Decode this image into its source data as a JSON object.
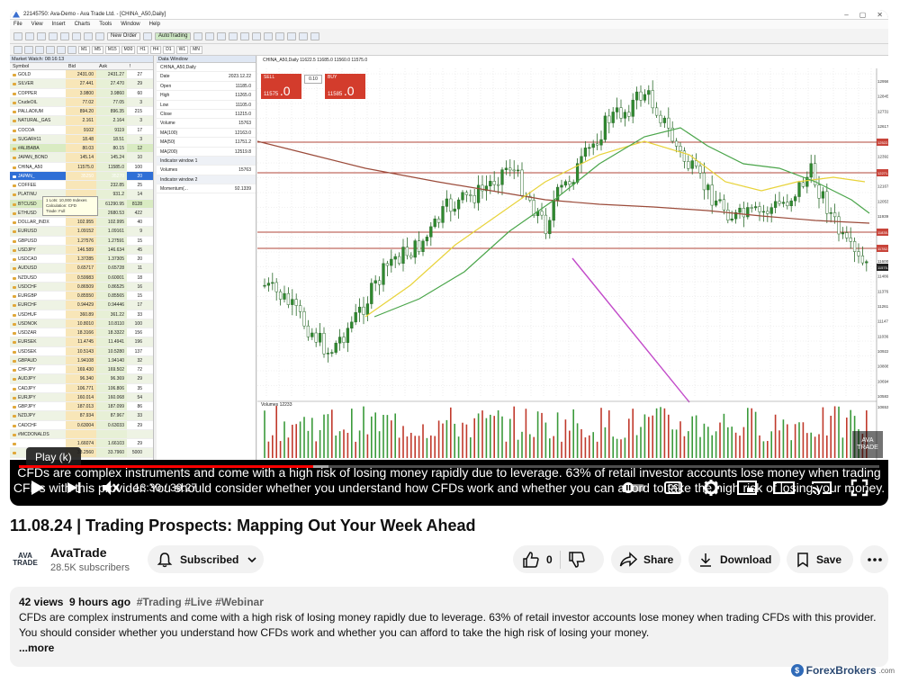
{
  "platform": {
    "title": "22145750: Ava-Demo - Ava Trade Ltd. - [CHINA_A50,Daily]",
    "menu": [
      "File",
      "View",
      "Insert",
      "Charts",
      "Tools",
      "Window",
      "Help"
    ],
    "toolbar": {
      "new_order": "New Order",
      "autotrading": "AutoTrading"
    },
    "timeframes": [
      "M1",
      "M5",
      "M15",
      "M30",
      "H1",
      "H4",
      "D1",
      "W1",
      "MN"
    ],
    "market_watch": {
      "title": "Market Watch: 08:16:13",
      "columns": [
        "Symbol",
        "Bid",
        "Ask",
        "!"
      ],
      "rows": [
        [
          "GOLD",
          "2431.00",
          "2431.27",
          "27"
        ],
        [
          "SILVER",
          "27.441",
          "27.470",
          "29"
        ],
        [
          "COPPER",
          "3.9800",
          "3.9860",
          "60"
        ],
        [
          "CrudeOIL",
          "77.02",
          "77.05",
          "3"
        ],
        [
          "PALLADIUM",
          "894.20",
          "896.35",
          "215"
        ],
        [
          "NATURAL_GAS",
          "2.161",
          "2.164",
          "3"
        ],
        [
          "COCOA",
          "9102",
          "9119",
          "17"
        ],
        [
          "SUGAR#11",
          "18.48",
          "18.51",
          "3"
        ],
        [
          "#ALIBABA",
          "80.03",
          "80.15",
          "12"
        ],
        [
          "JAPAN_BOND",
          "145.14",
          "145.24",
          "10"
        ],
        [
          "CHINA_A50",
          "11575.0",
          "11585.0",
          "100"
        ],
        [
          "JAPAN_",
          "35250",
          "35270",
          "20"
        ],
        [
          "COFFEE",
          "",
          "232.85",
          "25"
        ],
        [
          "PLATINU",
          "",
          "931.2",
          "14"
        ],
        [
          "BTCUSD",
          "",
          "61290.95",
          "8128"
        ],
        [
          "ETHUSD",
          "2676.31",
          "2680.53",
          "422"
        ],
        [
          "DOLLAR_INDX",
          "102.955",
          "102.995",
          "40"
        ],
        [
          "EURUSD",
          "1.09152",
          "1.09161",
          "9"
        ],
        [
          "GBPUSD",
          "1.27576",
          "1.27591",
          "15"
        ],
        [
          "USDJPY",
          "146.589",
          "146.634",
          "45"
        ],
        [
          "USDCAD",
          "1.37285",
          "1.37305",
          "20"
        ],
        [
          "AUDUSD",
          "0.65717",
          "0.65728",
          "11"
        ],
        [
          "NZDUSD",
          "0.59983",
          "0.60001",
          "18"
        ],
        [
          "USDCHF",
          "0.86509",
          "0.86525",
          "16"
        ],
        [
          "EURGBP",
          "0.85550",
          "0.85565",
          "15"
        ],
        [
          "EURCHF",
          "0.94429",
          "0.94446",
          "17"
        ],
        [
          "USDHUF",
          "360.89",
          "361.22",
          "33"
        ],
        [
          "USDNOK",
          "10.8010",
          "10.8110",
          "100"
        ],
        [
          "USDZAR",
          "18.3166",
          "18.3322",
          "156"
        ],
        [
          "EURSEK",
          "11.4745",
          "11.4941",
          "196"
        ],
        [
          "USDSEK",
          "10.5143",
          "10.5280",
          "137"
        ],
        [
          "GBPAUD",
          "1.94108",
          "1.94140",
          "32"
        ],
        [
          "CHFJPY",
          "169.430",
          "169.502",
          "72"
        ],
        [
          "AUDJPY",
          "96.340",
          "96.369",
          "29"
        ],
        [
          "CADJPY",
          "106.771",
          "106.806",
          "35"
        ],
        [
          "EURJPY",
          "160.014",
          "160.068",
          "54"
        ],
        [
          "GBPJPY",
          "187.013",
          "187.099",
          "86"
        ],
        [
          "NZDJPY",
          "87.934",
          "87.967",
          "33"
        ],
        [
          "CADCHF",
          "0.63004",
          "0.63033",
          "29"
        ],
        [
          "#MCDONALDS",
          "",
          "",
          ""
        ],
        [
          "",
          "1.66074",
          "1.66103",
          "29"
        ],
        [
          "",
          "33.2560",
          "33.7960",
          "5000"
        ]
      ],
      "tooltip": [
        "1 Lots: 10,000 Indexes",
        "Calculation: CFD",
        "Trade: Full"
      ]
    },
    "data_window": {
      "title": "Data Window",
      "rows": [
        [
          "CHINA_A50,Daily",
          ""
        ],
        [
          "Date",
          "2023.12.22"
        ],
        [
          "Open",
          "11185.0"
        ],
        [
          "High",
          "11265.0"
        ],
        [
          "Low",
          "11105.0"
        ],
        [
          "Close",
          "11215.0"
        ],
        [
          "Volume",
          "15763"
        ],
        [
          "MA(100)",
          "12163.0"
        ],
        [
          "MA(50)",
          "11751.2"
        ],
        [
          "MA(200)",
          "12519.8"
        ],
        [
          "Indicator window 1",
          ""
        ],
        [
          "Volumes",
          "15763"
        ],
        [
          "Indicator window 2",
          ""
        ],
        [
          "Momentum(...",
          "92.1339"
        ]
      ]
    },
    "chart": {
      "label": "CHINA_A50,Daily  11622.5 11685.0 11560.0 11575.0",
      "sell_label": "SELL",
      "buy_label": "BUY",
      "lot": "0.10",
      "sell_price_small": "11575",
      "sell_price_big": ".0",
      "buy_price_small": "11585",
      "buy_price_big": ".0",
      "price_ticks": [
        "12956.0",
        "12845.0",
        "12731.0",
        "12617.0",
        "12503.0",
        "12392.0",
        "12278.0",
        "12167.0",
        "12053.0",
        "11939.0",
        "11825.0",
        "11711.0",
        "11600.0",
        "11486.0",
        "11376.0",
        "11261.0",
        "11147.0",
        "11036.0",
        "10922.0",
        "10808.0",
        "10694.0",
        "10583.0"
      ],
      "price_tags": [
        "12522.5",
        "12271.5",
        "11835.5",
        "11782.5",
        "11575.0"
      ],
      "volume_label": "Volumes 12233",
      "volume_tick": "10653",
      "watermark": [
        "AVA",
        "TRADE"
      ]
    }
  },
  "player": {
    "play_tooltip": "Play (k)",
    "subtitle_line1": "CFDs are complex instruments and come with a high risk of losing money rapidly due to leverage. 63% of retail investor accounts lose money when trading",
    "subtitle_line2": "CFDs with this provider. You should consider whether you understand how CFDs work and whether you can afford to take the high risk of losing your money.",
    "time_current": "13:30",
    "time_total": "39:27",
    "progress_played": 0.342,
    "progress_loaded": 0.36,
    "cc_label": "CC"
  },
  "video": {
    "title": "11.08.24 | Trading Prospects: Mapping Out Your Week Ahead",
    "channel_name": "AvaTrade",
    "channel_logo_lines": [
      "AVA",
      "TRADE"
    ],
    "subscribers": "28.5K subscribers",
    "subscribed_label": "Subscribed",
    "likes": "0",
    "share_label": "Share",
    "download_label": "Download",
    "save_label": "Save",
    "views": "42 views",
    "age": "9 hours ago",
    "tags": "#Trading #Live #Webinar",
    "description": "CFDs are complex instruments and come with a high risk of losing money rapidly due to leverage. 63% of retail investor accounts lose money when trading CFDs with this provider. You should consider whether you understand how CFDs work and whether you can afford to take the high risk of losing your money.",
    "more_label": "...more"
  },
  "watermark": {
    "brand": "ForexBrokers",
    "suffix": ".com"
  },
  "colors": {
    "youtube_red": "#ff0000",
    "sell_red": "#d33c2c",
    "ma_green": "#4aa54a",
    "ma_yellow": "#e8d33a",
    "ma_brown": "#9b4b3a",
    "selected_row": "#2f6fd6"
  }
}
